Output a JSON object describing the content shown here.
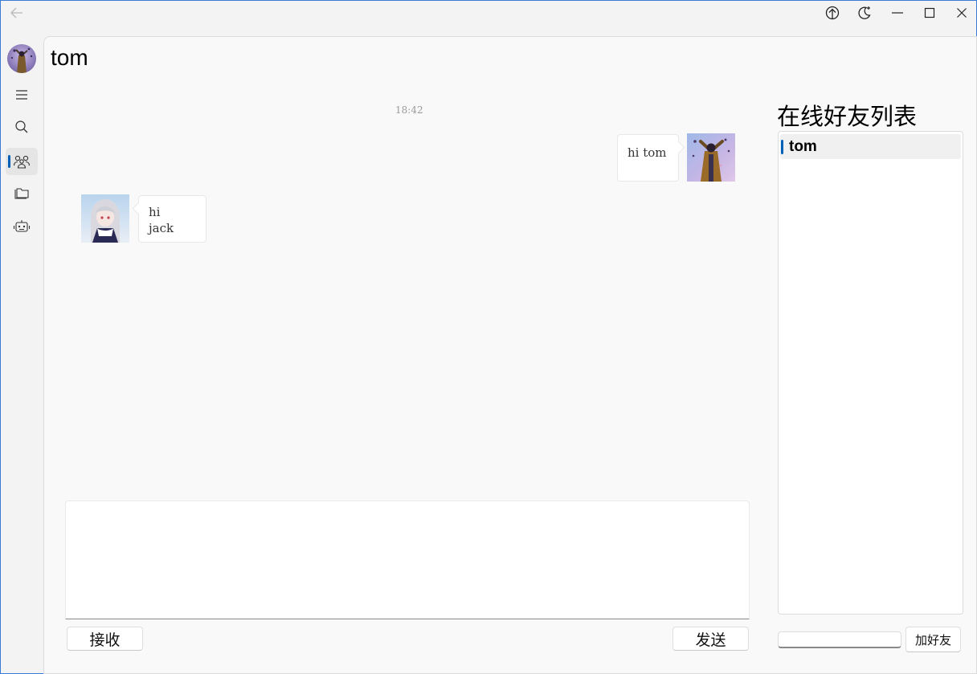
{
  "titlebar": {
    "icons": [
      "back-arrow-icon",
      "upload-icon",
      "theme-toggle-icon",
      "minimize-icon",
      "maximize-icon",
      "close-icon"
    ]
  },
  "nav": {
    "items": [
      {
        "icon": "menu-icon"
      },
      {
        "icon": "search-icon"
      },
      {
        "icon": "friends-icon",
        "active": true
      },
      {
        "icon": "folder-icon"
      },
      {
        "icon": "robot-icon"
      }
    ]
  },
  "chat": {
    "title": "tom",
    "timestamp": "18:42",
    "messages": [
      {
        "side": "right",
        "line1": "hi tom",
        "line2": ""
      },
      {
        "side": "left",
        "line1": "hi",
        "line2": "jack"
      }
    ],
    "input_value": "",
    "receive_label": "接收",
    "send_label": "发送"
  },
  "friends": {
    "title": "在线好友列表",
    "items": [
      {
        "name": "tom"
      }
    ],
    "add_input_value": "",
    "add_label": "加好友"
  },
  "colors": {
    "accent": "#005fb8",
    "panel_bg": "#f9f9f9",
    "window_bg": "#f3f3f3"
  }
}
